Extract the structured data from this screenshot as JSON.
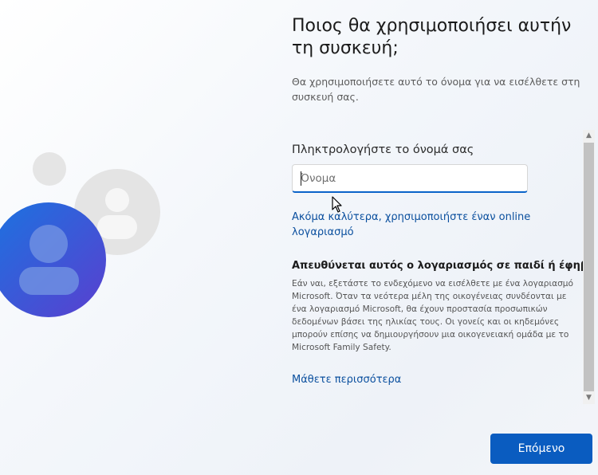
{
  "header": {
    "title": "Ποιος θα χρησιμοποιήσει αυτήν τη συσκευή;",
    "subtitle": "Θα χρησιμοποιήσετε αυτό το όνομα για να εισέλθετε στη συσκευή σας."
  },
  "form": {
    "name_label": "Πληκτρολογήστε το όνομά σας",
    "name_placeholder": "Όνομα",
    "name_value": "",
    "online_account_link": "Ακόμα καλύτερα, χρησιμοποιήστε έναν online λογαριασμό"
  },
  "child_section": {
    "heading": "Απευθύνεται αυτός ο λογαριασμός σε παιδί ή έφηβο;",
    "body": "Εάν ναι, εξετάστε το ενδεχόμενο να εισέλθετε με ένα λογαριασμό Microsoft. Όταν τα νεότερα μέλη της οικογένειας συνδέονται με ένα λογαριασμό Microsoft, θα έχουν προστασία προσωπικών δεδομένων βάσει της ηλικίας τους. Οι γονείς και οι κηδεμόνες μπορούν επίσης να δημιουργήσουν μια οικογενειακή ομάδα με το Microsoft Family Safety.",
    "learn_more_link": "Μάθετε περισσότερα"
  },
  "footer": {
    "next_label": "Επόμενο"
  },
  "icons": {
    "scroll_up": "▲",
    "scroll_down": "▼"
  },
  "colors": {
    "accent": "#0a5cc0",
    "link": "#0a4f9e",
    "avatar_front": "#2f5fd0",
    "avatar_back": "#e3e3e3"
  }
}
